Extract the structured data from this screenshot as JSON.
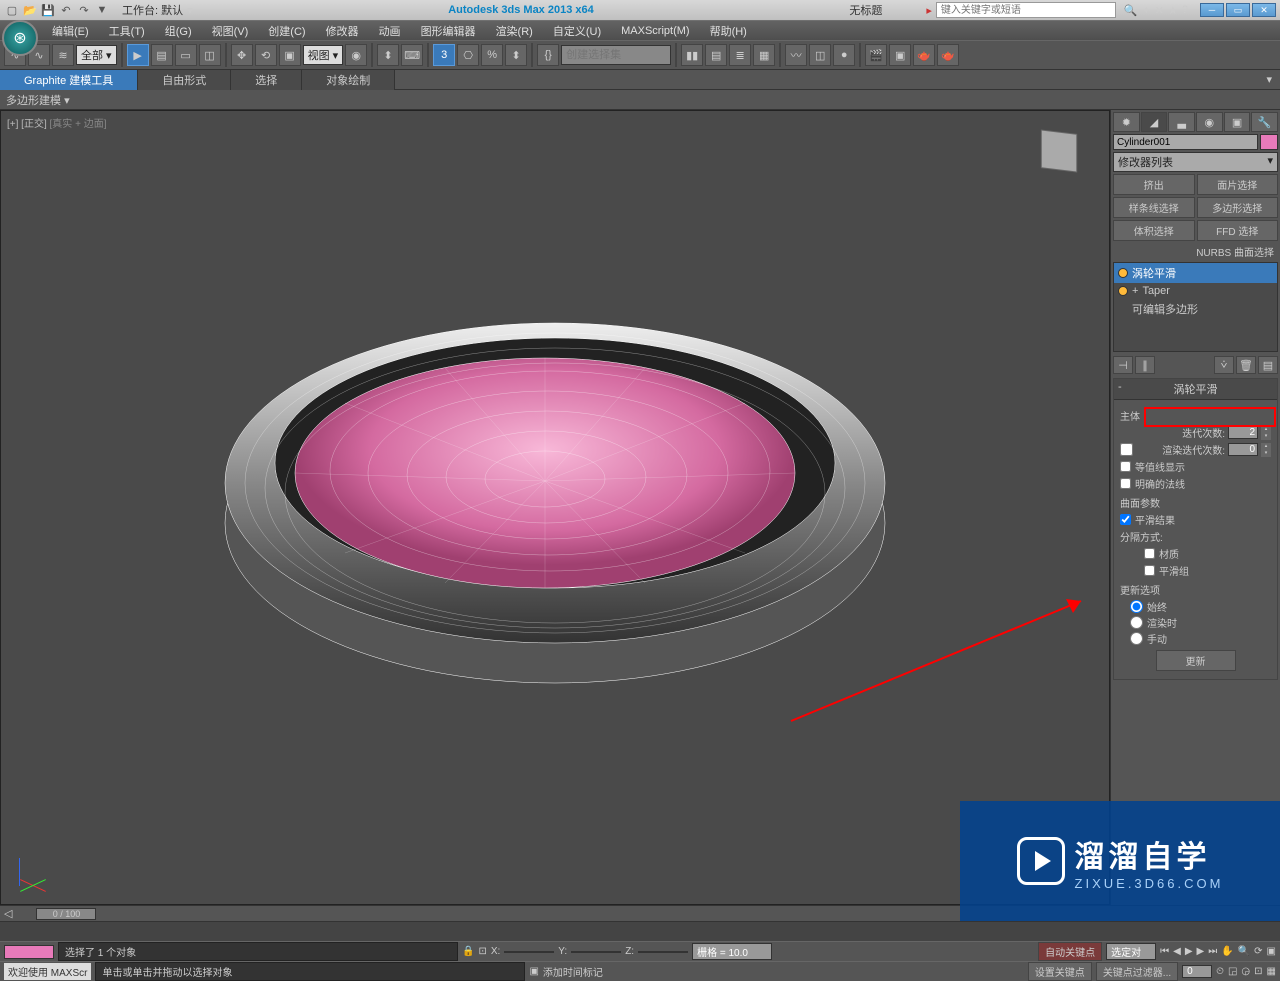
{
  "titlebar": {
    "workspace_label": "工作台: 默认",
    "app_title": "Autodesk 3ds Max  2013 x64",
    "doc_title": "无标题",
    "search_placeholder": "键入关键字或短语"
  },
  "menus": [
    "编辑(E)",
    "工具(T)",
    "组(G)",
    "视图(V)",
    "创建(C)",
    "修改器",
    "动画",
    "图形编辑器",
    "渲染(R)",
    "自定义(U)",
    "MAXScript(M)",
    "帮助(H)"
  ],
  "toolbar": {
    "filter_dropdown": "全部",
    "view_dropdown": "视图",
    "selset_placeholder": "创建选择集"
  },
  "ribbon": {
    "tabs": [
      "Graphite 建模工具",
      "自由形式",
      "选择",
      "对象绘制"
    ],
    "sub_label": "多边形建模"
  },
  "viewport": {
    "label_prefix": "[+] [正交]",
    "label_suffix": "[真实 + 边面]"
  },
  "cmd_panel": {
    "object_name": "Cylinder001",
    "mod_list_label": "修改器列表",
    "mod_buttons": [
      "挤出",
      "面片选择",
      "样条线选择",
      "多边形选择",
      "体积选择",
      "FFD 选择"
    ],
    "mod_subtext": "NURBS 曲面选择",
    "stack": [
      {
        "name": "涡轮平滑",
        "on": true,
        "selected": true
      },
      {
        "name": "Taper",
        "on": true,
        "selected": false,
        "expand": "+"
      },
      {
        "name": "可编辑多边形",
        "on": true,
        "selected": false
      }
    ],
    "rollout_title": "涡轮平滑",
    "main_group": "主体",
    "iterations_label": "迭代次数:",
    "iterations_value": "2",
    "render_iter_label": "渲染迭代次数:",
    "render_iter_value": "0",
    "isoline_label": "等值线显示",
    "explicit_label": "明确的法线",
    "surface_group": "曲面参数",
    "smooth_result_label": "平滑结果",
    "separate_label": "分隔方式:",
    "material_label": "材质",
    "smoothgrp_label": "平滑组",
    "update_group": "更新选项",
    "update_always": "始终",
    "update_render": "渲染时",
    "update_manual": "手动",
    "update_btn": "更新"
  },
  "timeslider": {
    "pos": "0 / 100"
  },
  "status": {
    "selection": "选择了 1 个对象",
    "prompt": "单击或单击并拖动以选择对象",
    "welcome": "欢迎使用  MAXScr",
    "x_label": "X:",
    "y_label": "Y:",
    "z_label": "Z:",
    "grid": "栅格 = 10.0",
    "autokey": "自动关键点",
    "selkey_dd": "选定对",
    "add_time_tag": "添加时间标记",
    "setkey": "设置关键点",
    "keyfilter": "关键点过滤器..."
  },
  "watermark": {
    "brand": "溜溜自学",
    "url": "ZIXUE.3D66.COM"
  }
}
